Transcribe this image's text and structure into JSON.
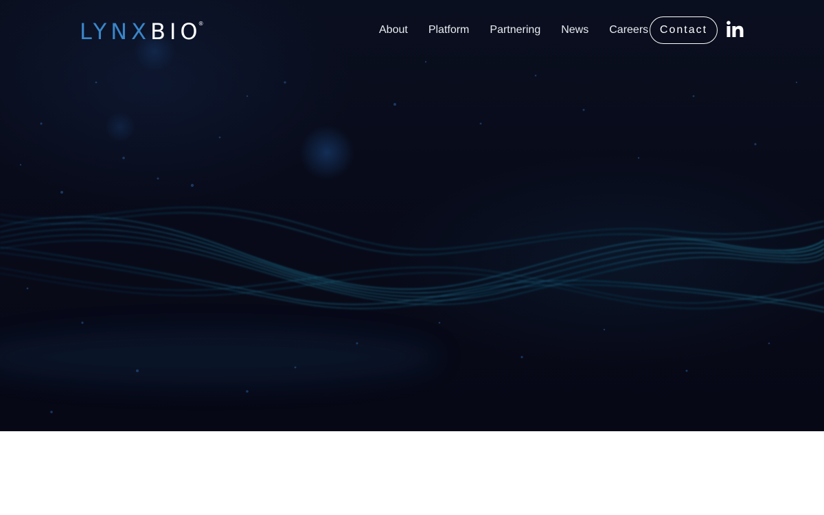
{
  "brand": {
    "logo_part1": "LYNX",
    "logo_part2": "BIO",
    "logo_mark": "®",
    "logo_colors": {
      "lynx": "#3a86c8",
      "bio": "#ffffff"
    }
  },
  "nav": {
    "items": [
      {
        "label": "About"
      },
      {
        "label": "Platform"
      },
      {
        "label": "Partnering"
      },
      {
        "label": "News"
      },
      {
        "label": "Careers"
      }
    ],
    "contact_label": "Contact",
    "social_icon": "linkedin-icon"
  },
  "hero": {
    "background_color": "#080b1a",
    "wave_color": "#1aa0c8"
  },
  "content": {
    "background_color": "#ffffff"
  }
}
